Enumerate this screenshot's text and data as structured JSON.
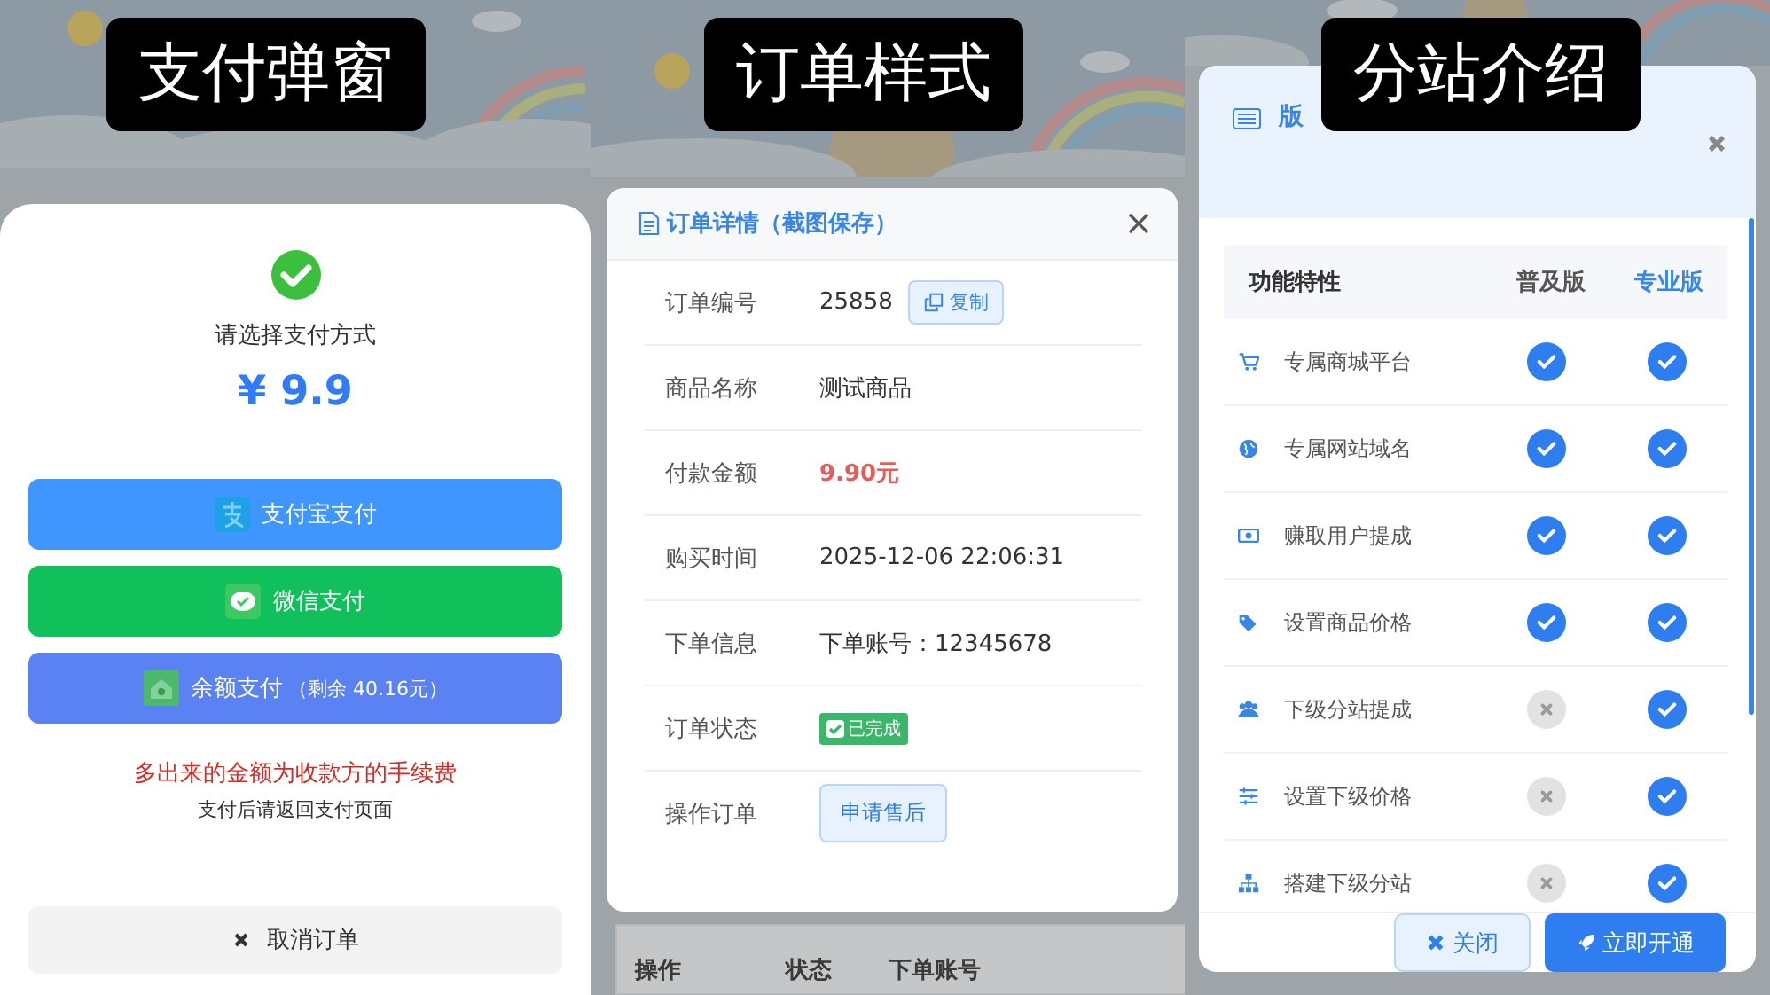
{
  "payment_sheet": {
    "caption": "支付弹窗",
    "title": "请选择支付方式",
    "price": "¥ 9.9",
    "methods": [
      {
        "kind": "alipay",
        "label": "支付宝支付",
        "color": "#4096ff"
      },
      {
        "kind": "wechat",
        "label": "微信支付",
        "color": "#10c05a"
      },
      {
        "kind": "balance",
        "label": "余额支付",
        "note": "（剩余 40.16元）",
        "color": "#5b82f2"
      }
    ],
    "fee_note": "多出来的金额为收款方的手续费",
    "return_note": "支付后请返回支付页面",
    "cancel": "取消订单"
  },
  "order_detail": {
    "caption": "订单样式",
    "title": "订单详情（截图保存）",
    "rows": [
      {
        "kind": "copy",
        "label": "订单编号",
        "value": "25858",
        "button": "复制"
      },
      {
        "kind": "text",
        "label": "商品名称",
        "value": "测试商品"
      },
      {
        "kind": "amount",
        "label": "付款金额",
        "value": "9.90元"
      },
      {
        "kind": "text",
        "label": "购买时间",
        "value": "2025-12-06 22:06:31"
      },
      {
        "kind": "text",
        "label": "下单信息",
        "value": "下单账号：12345678"
      },
      {
        "kind": "status",
        "label": "订单状态",
        "value": "已完成"
      },
      {
        "kind": "action",
        "label": "操作订单",
        "button": "申请售后"
      }
    ],
    "table_columns": [
      "操作",
      "状态",
      "下单账号"
    ]
  },
  "branch_intro": {
    "caption": "分站介绍",
    "title": "版",
    "columns": [
      "功能特性",
      "普及版",
      "专业版"
    ],
    "features": [
      {
        "label": "专属商城平台",
        "basic": true,
        "pro": true
      },
      {
        "label": "专属网站域名",
        "basic": true,
        "pro": true
      },
      {
        "label": "赚取用户提成",
        "basic": true,
        "pro": true
      },
      {
        "label": "设置商品价格",
        "basic": true,
        "pro": true
      },
      {
        "label": "下级分站提成",
        "basic": false,
        "pro": true
      },
      {
        "label": "设置下级价格",
        "basic": false,
        "pro": true
      },
      {
        "label": "搭建下级分站",
        "basic": false,
        "pro": true
      }
    ],
    "buttons": [
      "关闭",
      "立即开通"
    ]
  }
}
